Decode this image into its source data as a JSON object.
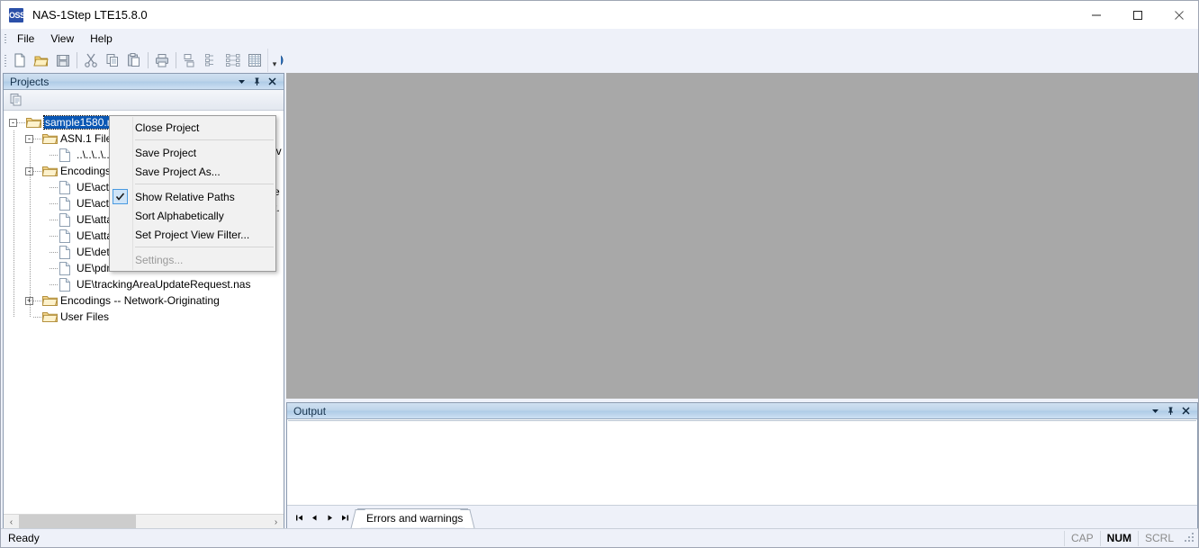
{
  "window": {
    "app_badge": "OSS",
    "title": "NAS-1Step LTE15.8.0",
    "minimize": "–",
    "maximize": "□",
    "close": "✕"
  },
  "menubar": {
    "items": [
      {
        "label": "File"
      },
      {
        "label": "View"
      },
      {
        "label": "Help"
      }
    ]
  },
  "toolbar": {
    "buttons": [
      {
        "name": "new-icon",
        "title": "New"
      },
      {
        "name": "open-folder-icon",
        "title": "Open"
      },
      {
        "name": "save-icon",
        "title": "Save"
      },
      {
        "name": "cut-icon",
        "title": "Cut"
      },
      {
        "name": "copy-icon",
        "title": "Copy"
      },
      {
        "name": "paste-icon",
        "title": "Paste"
      },
      {
        "name": "print-icon",
        "title": "Print"
      },
      {
        "name": "encode-icon",
        "title": "Encode"
      },
      {
        "name": "decode-icon",
        "title": "Decode"
      },
      {
        "name": "tree-view-icon",
        "title": "Tree view"
      },
      {
        "name": "grid-view-icon",
        "title": "Grid view"
      },
      {
        "name": "help-icon",
        "title": "Help"
      }
    ],
    "overflow_label": "▾"
  },
  "projects_panel": {
    "title": "Projects",
    "caption_buttons": [
      {
        "name": "panel-menu-icon",
        "glyph": "▼"
      },
      {
        "name": "pin-icon",
        "glyph": "pin"
      },
      {
        "name": "close-icon",
        "glyph": "✕"
      }
    ],
    "toolbar_button": {
      "name": "project-properties-icon"
    },
    "tree": [
      {
        "level": 0,
        "expander": "-",
        "icon": "folder",
        "label": "sample1580.nas",
        "selected": true
      },
      {
        "level": 1,
        "expander": "-",
        "icon": "folder",
        "label": "ASN.1 Files",
        "selected": false
      },
      {
        "level": 2,
        "expander": "",
        "icon": "file",
        "label": "..\\..\\..\\..\\...",
        "selected": false
      },
      {
        "level": 1,
        "expander": "-",
        "icon": "folder",
        "label": "Encodings",
        "selected": false
      },
      {
        "level": 2,
        "expander": "",
        "icon": "file",
        "label": "UE\\acti...",
        "selected": false
      },
      {
        "level": 2,
        "expander": "",
        "icon": "file",
        "label": "UE\\acti...",
        "selected": false
      },
      {
        "level": 2,
        "expander": "",
        "icon": "file",
        "label": "UE\\atta...",
        "selected": false
      },
      {
        "level": 2,
        "expander": "",
        "icon": "file",
        "label": "UE\\atta...",
        "selected": false
      },
      {
        "level": 2,
        "expander": "",
        "icon": "file",
        "label": "UE\\det...",
        "selected": false
      },
      {
        "level": 2,
        "expander": "",
        "icon": "file",
        "label": "UE\\pdn...",
        "selected": false
      },
      {
        "level": 2,
        "expander": "",
        "icon": "file",
        "label": "UE\\trackingAreaUpdateRequest.nas",
        "selected": false
      },
      {
        "level": 1,
        "expander": "+",
        "icon": "folder",
        "label": "Encodings -- Network-Originating",
        "selected": false
      },
      {
        "level": 1,
        "expander": "",
        "icon": "folder",
        "label": "User Files",
        "selected": false
      }
    ],
    "scrollbar": {
      "left_arrow": "‹",
      "right_arrow": "›"
    }
  },
  "context_menu": {
    "items": [
      {
        "label": "Close Project",
        "checked": false,
        "disabled": false,
        "separator_after": true
      },
      {
        "label": "Save Project",
        "checked": false,
        "disabled": false,
        "separator_after": false
      },
      {
        "label": "Save Project As...",
        "checked": false,
        "disabled": false,
        "separator_after": true
      },
      {
        "label": "Show Relative Paths",
        "checked": true,
        "disabled": false,
        "separator_after": false
      },
      {
        "label": "Sort Alphabetically",
        "checked": false,
        "disabled": false,
        "separator_after": false
      },
      {
        "label": "Set Project View Filter...",
        "checked": false,
        "disabled": false,
        "separator_after": true
      },
      {
        "label": "Settings...",
        "checked": false,
        "disabled": true,
        "separator_after": false
      }
    ]
  },
  "obscured_text": {
    "line1": "lv",
    "line2": "e",
    "line3": "t."
  },
  "output_panel": {
    "title": "Output",
    "caption_buttons": [
      {
        "name": "panel-menu-icon",
        "glyph": "▼"
      },
      {
        "name": "pin-icon",
        "glyph": "pin"
      },
      {
        "name": "close-icon",
        "glyph": "✕"
      }
    ],
    "nav_buttons": [
      {
        "name": "nav-first-icon",
        "glyph": "⏮"
      },
      {
        "name": "nav-prev-icon",
        "glyph": "◀"
      },
      {
        "name": "nav-next-icon",
        "glyph": "▶"
      },
      {
        "name": "nav-last-icon",
        "glyph": "⏭"
      }
    ],
    "tabs": [
      {
        "label": "Errors and warnings",
        "active": true
      }
    ],
    "content": ""
  },
  "statusbar": {
    "message": "Ready",
    "indicators": [
      {
        "label": "CAP",
        "active": false
      },
      {
        "label": "NUM",
        "active": true
      },
      {
        "label": "SCRL",
        "active": false
      }
    ]
  },
  "colors": {
    "accent": "#0a57b4",
    "panel_caption": "#bdd4ea",
    "editor_bg": "#a8a8a8",
    "chrome_bg": "#eef1f9"
  }
}
